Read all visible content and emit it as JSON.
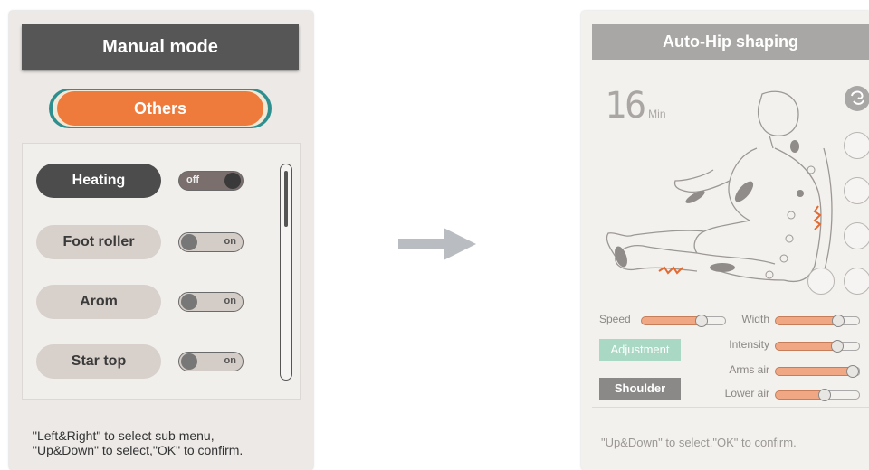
{
  "manual_panel": {
    "title": "Manual mode",
    "tab": "Others",
    "items": [
      {
        "label": "Heating",
        "active": true,
        "toggle": "off"
      },
      {
        "label": "Foot roller",
        "active": false,
        "toggle": "on"
      },
      {
        "label": "Arom",
        "active": false,
        "toggle": "on"
      },
      {
        "label": "Star top",
        "active": false,
        "toggle": "on"
      }
    ],
    "footer_line1": "\"Left&Right\" to select sub menu,",
    "footer_line2": "\"Up&Down\" to select,\"OK\" to confirm."
  },
  "auto_panel": {
    "title": "Auto-Hip shaping",
    "timer_value": "16",
    "timer_unit": "Min",
    "speed_label": "Speed",
    "width_label": "Width",
    "intensity_label": "Intensity",
    "arms_air_label": "Arms air",
    "lower_air_label": "Lower air",
    "adjustment_button": "Adjustment",
    "shoulder_button": "Shoulder",
    "footer": "\"Up&Down\" to select,\"OK\" to confirm.",
    "levels": {
      "speed": 0.75,
      "width": 0.8,
      "intensity": 0.78,
      "arms_air": 1.0,
      "lower_air": 0.6
    }
  },
  "colors": {
    "accent_orange": "#ee7a3b",
    "title_dark": "#565656",
    "title_light": "#a9a7a5",
    "adjust_green": "#a9d8c4",
    "arrow_gray": "#b9bcc0"
  },
  "icons": [
    "arrow-right-icon",
    "massage-head-icon"
  ]
}
